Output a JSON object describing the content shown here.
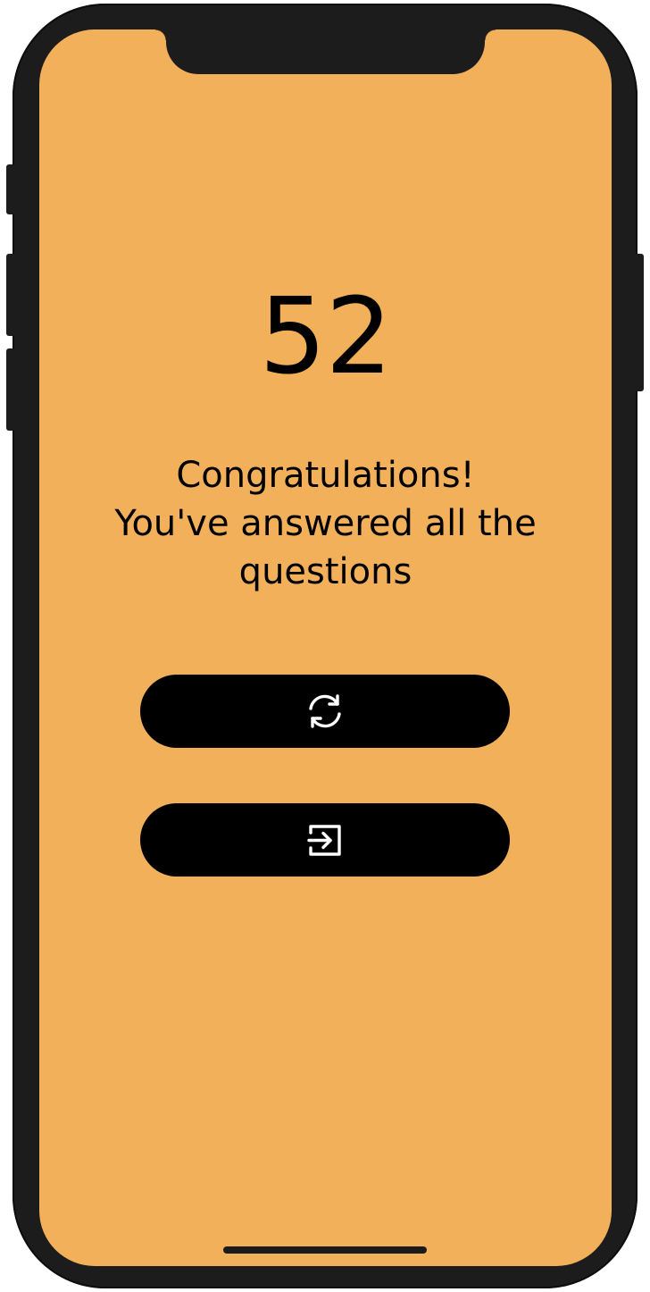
{
  "score": {
    "value": "52"
  },
  "message": {
    "line1": "Congratulations!",
    "line2": "You've answered all the",
    "line3": "questions"
  },
  "actions": {
    "restart": {
      "icon": "refresh-icon"
    },
    "exit": {
      "icon": "exit-icon"
    }
  },
  "colors": {
    "background": "#f2b05a",
    "button": "#000000",
    "icon": "#ffffff",
    "text": "#000000",
    "device_frame": "#1c1c1c"
  }
}
